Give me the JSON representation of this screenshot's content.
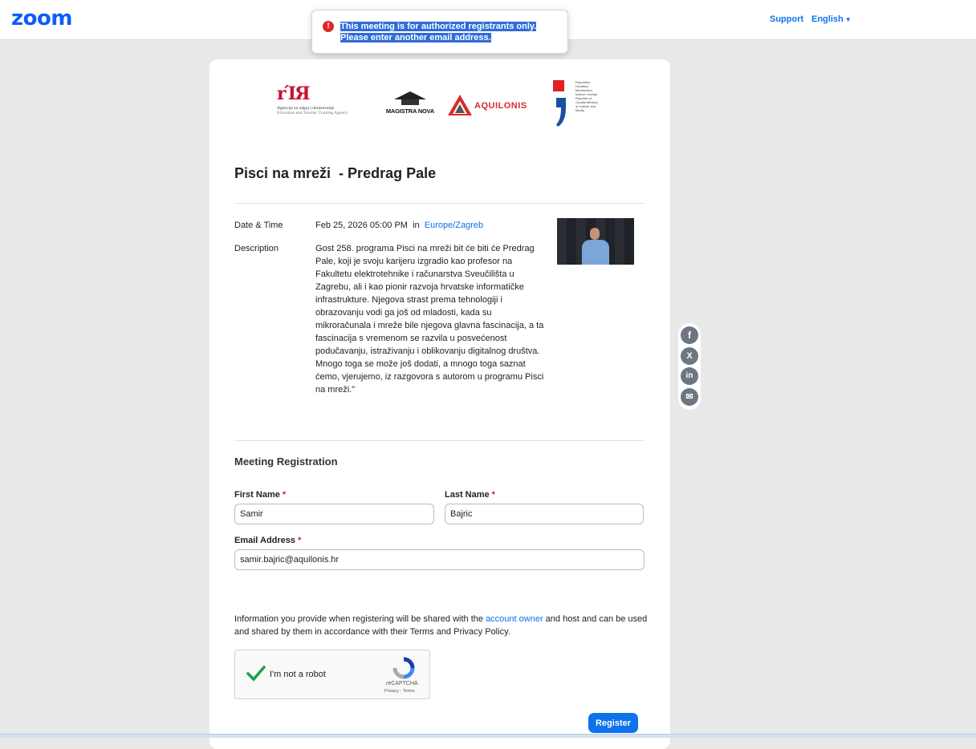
{
  "header": {
    "logo": "zoom",
    "support": "Support",
    "language": "English"
  },
  "toast": {
    "line1": "This meeting is for authorized registrants only.",
    "line2": "Please enter another email address.",
    "icon": "!"
  },
  "sponsors": {
    "azoo_mark": "rΊЯ",
    "azoo_line1": "Agencija za odgoj i obrazovanje",
    "azoo_line2": "Education and Teacher Training Agency",
    "magistra": "MAGISTRA NOVA",
    "aquilonis": "AQUILONIS",
    "ministry_text": "Republika Hrvatska Ministarstvo kulture i medija Republic of Croatia Ministry of Culture and Media"
  },
  "meeting": {
    "title": "Pisci na mreži  - Predrag Pale",
    "date_label": "Date & Time",
    "date_value": "Feb 25, 2026 05:00 PM",
    "date_in": "in",
    "timezone": "Europe/Zagreb",
    "description_label": "Description",
    "description": "Gost 258. programa Pisci na mreži bit će biti će Predrag Pale, koji je svoju karijeru izgradio kao profesor na Fakultetu elektrotehnike i računarstva Sveučilišta u Zagrebu, ali i kao pionir razvoja hrvatske informatičke infrastrukture. Njegova strast prema tehnologiji i obrazovanju vodi ga još od mladosti, kada su mikroračunala i mreže bile njegova glavna fascinacija, a ta fascinacija s vremenom se razvila u posvećenost podučavanju, istraživanju i oblikovanju digitalnog društva. Mnogo toga se može još dodati, a mnogo toga saznat ćemo, vjerujemo, iz razgovora s autorom u programu Pisci na mreži.\""
  },
  "registration": {
    "section_title": "Meeting Registration",
    "first_name_label": "First Name",
    "first_name_value": "Samir",
    "last_name_label": "Last Name",
    "last_name_value": "Bajric",
    "email_label": "Email Address",
    "email_value": "samir.bajric@aquilonis.hr",
    "required_mark": "*",
    "disclaimer_before": "Information you provide when registering will be shared with the ",
    "disclaimer_link": "account owner",
    "disclaimer_after": " and host and can be used and shared by them in accordance with their Terms and Privacy Policy.",
    "captcha_label": "I'm not a robot",
    "captcha_brand": "reCAPTCHA",
    "captcha_links": "Privacy - Terms",
    "register": "Register"
  },
  "share": {
    "facebook": "f",
    "x": "X",
    "linkedin": "in",
    "email": "✉"
  },
  "colors": {
    "brand": "#0b5cff",
    "link": "#0e72ed",
    "error": "#e02828",
    "required": "#d21f1f"
  }
}
